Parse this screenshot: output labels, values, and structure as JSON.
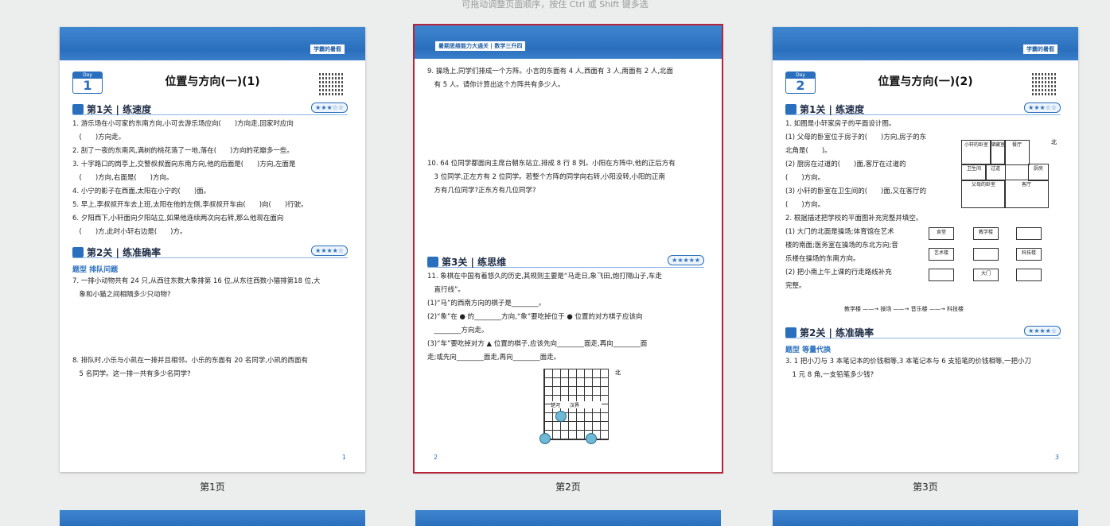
{
  "hint": "可拖动调整页面顺序，按住 Ctrl 或 Shift 键多选",
  "pages": [
    {
      "caption": "第1页",
      "tag": "学霸的暑假",
      "day_label": "Day",
      "day_number": "1",
      "title": "位置与方向(一)(1)",
      "sec1": "第1关 | 练速度",
      "sec1_stars": "★★★☆☆",
      "lines1": [
        "1. 游乐场在小可家的东南方向,小可去游乐场应向(　　)方向走,回家时应向",
        "　(　　)方向走。",
        "2. 刮了一夜的东南风,满树的桃花落了一地,落在(　　)方向的花瓣多一些。",
        "3. 十字路口的岗亭上,交警叔叔面向东南方向,他的后面是(　　)方向,左面是",
        "　(　　)方向,右面是(　　)方向。",
        "4. 小宁的影子在西面,太阳在小宁的(　　)面。",
        "5. 早上,李叔叔开车去上班,太阳在他的左侧,李叔叔开车由(　　)向(　　)行驶。",
        "6. 夕阳西下,小轩面向夕阳站立,如果他连续两次向右转,那么他现在面向",
        "　(　　)方,此时小轩右边是(　　)方。"
      ],
      "sec2": "第2关 | 练准确率",
      "sec2_stars": "★★★★☆",
      "sub": "题型 排队问题",
      "q7a": "7. 一排小动物共有 24 只,从西往东数大象排第 16 位,从东往西数小猫排第18 位,大",
      "q7b": "　象和小猫之间相隔多少只动物?",
      "q8a": "8. 排队时,小乐与小凯在一排并且相邻。小乐的东面有 20 名同学,小凯的西面有",
      "q8b": "　5 名同学。这一排一共有多少名同学?",
      "page_no": "1"
    },
    {
      "caption": "第2页",
      "tag": "暑期思维能力大通关 | 数学三升四",
      "q9a": "9. 操场上,同学们排成一个方阵。小言的东面有 4 人,西面有 3 人,南面有 2 人,北面",
      "q9b": "　有 5 人。请你计算出这个方阵共有多少人。",
      "q10a": "10. 64 位同学都面向主席台朝东站立,排成 8 行 8 列。小阳在方阵中,他的正后方有",
      "q10b": "　3 位同学,正左方有 2 位同学。若整个方阵的同学向右转,小阳没转,小阳的正南",
      "q10c": "　方有几位同学?正东方有几位同学?",
      "sec3": "第3关 | 练思维",
      "sec3_stars": "★★★★★",
      "lines11": [
        "11. 象棋在中国有着悠久的历史,其规则主要是“马走日,象飞田,炮打隔山子,车走",
        "　直行线”。",
        "(1)“马”的西南方向的棋子是________。",
        "(2)“象”在 ● 的________方向,“象”要吃掉位于 ● 位置的对方棋子应该向",
        "　________方向走。",
        "(3)“车”要吃掉对方 ▲ 位置的棋子,应该先向________面走,再向________面",
        "走;或先向________面走,再向________面走。"
      ],
      "board_river": "楚河　　汉界",
      "north": "北",
      "page_no": "2"
    },
    {
      "caption": "第3页",
      "tag": "学霸的暑假",
      "day_label": "Day",
      "day_number": "2",
      "title": "位置与方向(一)(2)",
      "sec1": "第1关 | 练速度",
      "sec1_stars": "★★★☆☆",
      "lines1": [
        "1. 如图是小轩家房子的平面设计图。",
        "(1) 父母的卧室位于房子的(　　)方向,房子的东",
        "北角是(　　)。",
        "(2) 厨房在过道的(　　)面,客厅在过道的",
        "(　　)方向。",
        "(3) 小轩的卧室在卫生间的(　　)面,又在客厅的",
        "(　　)方向。",
        "2. 根据描述把学校的平面图补充完整并填空。",
        "(1) 大门的北面是操场;体育馆在艺术",
        "楼的南面;医务室在操场的东北方向;音",
        "乐楼在操场的东南方向。",
        "(2) 把小南上午上课的行走路线补充",
        "完整。"
      ],
      "plan_rooms": [
        "小轩的卧室",
        "储藏室",
        "餐厅",
        "卫生间",
        "过道",
        "厨房",
        "父母的卧室",
        "客厅"
      ],
      "school": [
        "食堂",
        "教学楼",
        "艺术楼",
        "科技楼",
        "大门"
      ],
      "route": "教学楼 ——→ 操场 ——→ 音乐楼 ——→ 科技楼",
      "sec2": "第2关 | 练准确率",
      "sec2_stars": "★★★★☆",
      "sub": "题型 等量代换",
      "q3a": "3. 1 把小刀与 3 本笔记本的价钱相等,3 本笔记本与 6 支铅笔的价钱相等,一把小刀",
      "q3b": "　1 元 8 角,一支铅笔多少钱?",
      "north": "北",
      "page_no": "3"
    }
  ]
}
